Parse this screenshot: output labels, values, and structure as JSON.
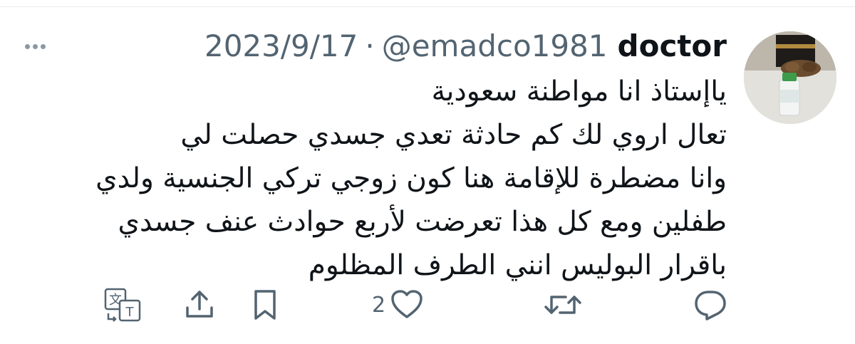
{
  "tweet": {
    "author_name": "doctor",
    "handle": "@emadco1981",
    "separator": "·",
    "date": "2023/9/17",
    "lines": [
      "ياإستاذ انا مواطنة سعودية",
      "تعال اروي لك كم حادثة تعدي جسدي حصلت لي",
      "وانا مضطرة للإقامة هنا كون زوجي تركي الجنسية ولدي",
      "طفلين ومع كل هذا تعرضت لأربع حوادث عنف جسدي",
      "باقرار البوليس انني الطرف المظلوم"
    ]
  },
  "actions": {
    "like_count": "2"
  },
  "icons": {
    "more": "more-horizontal-icon",
    "translate": "translate-icon",
    "share": "share-icon",
    "bookmark": "bookmark-icon",
    "like": "heart-icon",
    "retweet": "retweet-icon",
    "reply": "reply-icon"
  },
  "colors": {
    "text": "#0f1419",
    "secondary": "#536471",
    "icon": "#536471",
    "divider": "#e6e9ec"
  }
}
